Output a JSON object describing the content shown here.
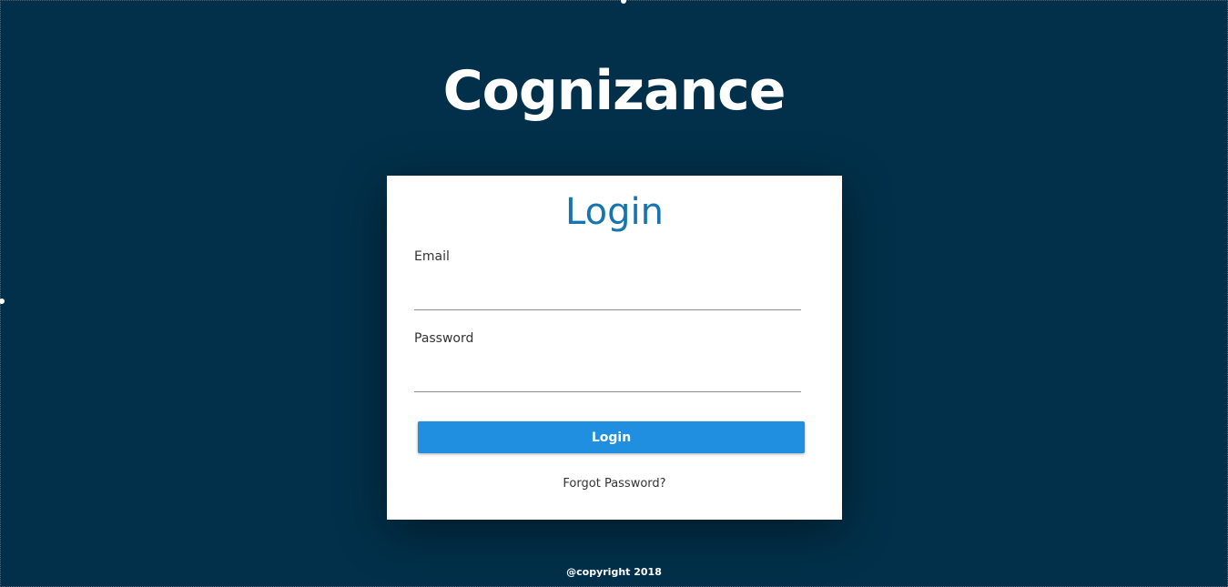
{
  "app": {
    "title": "Cognizance"
  },
  "login_card": {
    "heading": "Login",
    "email": {
      "label": "Email",
      "value": "",
      "placeholder": ""
    },
    "password": {
      "label": "Password",
      "value": "",
      "placeholder": ""
    },
    "submit_label": "Login",
    "forgot_password_label": "Forgot Password?"
  },
  "footer": {
    "copyright": "@copyright 2018"
  },
  "colors": {
    "background": "#02304a",
    "heading_accent": "#1575b0",
    "button": "#218fe0",
    "card": "#ffffff"
  }
}
